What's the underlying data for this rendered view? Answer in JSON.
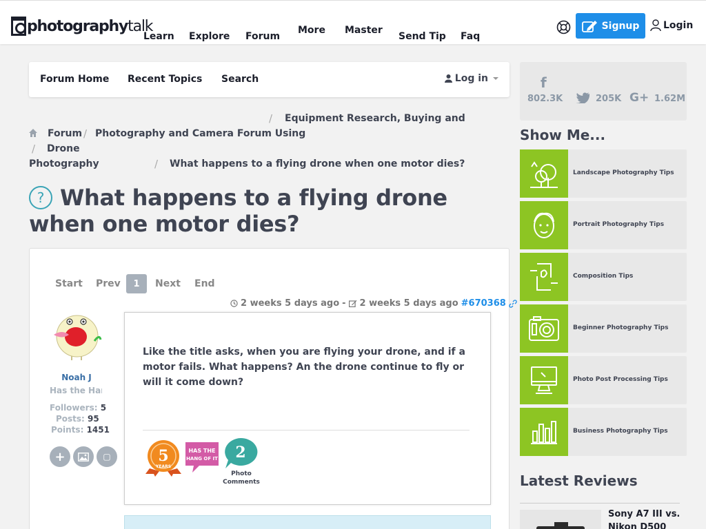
{
  "nav": {
    "logo_main": "photography",
    "logo_suffix": "talk",
    "links": [
      "Learn",
      "Explore",
      "Forum",
      "More",
      "Master",
      "Send Tip",
      "Faq"
    ],
    "signup_label": "Signup",
    "login_label": "Login"
  },
  "toolbar": {
    "items": [
      "Forum Home",
      "Recent Topics",
      "Search"
    ],
    "login_label": "Log in"
  },
  "breadcrumb": {
    "forum": "Forum",
    "category": "Photography and Camera Forum Using",
    "subcategory": "Equipment Research, Buying and",
    "drone": "Drone",
    "photography": "Photography",
    "current": "What happens to a flying drone when one motor dies?",
    "separator": "/"
  },
  "topic": {
    "title": "What happens to a flying drone when one motor dies?"
  },
  "pager": {
    "start": "Start",
    "prev": "Prev",
    "current": "1",
    "next": "Next",
    "end": "End"
  },
  "post": {
    "created": "2 weeks 5 days ago",
    "meta_sep": "-",
    "edited": "2 weeks 5 days ago",
    "post_id": "#670368",
    "body": "Like the title asks, when you are flying your drone, and if a motor fails.  What happens?  An the drone continue to fly or will it come down?",
    "badge_years_num": "5",
    "badge_years_label": "YEARS",
    "badge_hang_line1": "HAS THE",
    "badge_hang_line2": "HANG OF IT",
    "badge_comments_num": "2",
    "badge_comments_caption": "Photo Comments"
  },
  "user": {
    "name": "Noah J",
    "rank": "Has the Hang of It",
    "followers_label": "Followers:",
    "followers": "5",
    "posts_label": "Posts:",
    "posts": "95",
    "points_label": "Points:",
    "points": "1451"
  },
  "social": {
    "facebook": "802.3K",
    "twitter": "205K",
    "google": "1.62M"
  },
  "sidebar": {
    "show_me_heading": "Show Me...",
    "tips": [
      "Landscape Photography Tips",
      "Portrait Photography Tips",
      "Composition Tips",
      "Beginner Photography Tips",
      "Photo Post Processing Tips",
      "Business Photography Tips"
    ],
    "reviews_heading": "Latest Reviews",
    "review_title": "Sony A7 III vs. Nikon D500"
  },
  "colors": {
    "accent_blue": "#1e8ee8",
    "tip_green": "#8dc523",
    "question_teal": "#3aa4b6"
  }
}
